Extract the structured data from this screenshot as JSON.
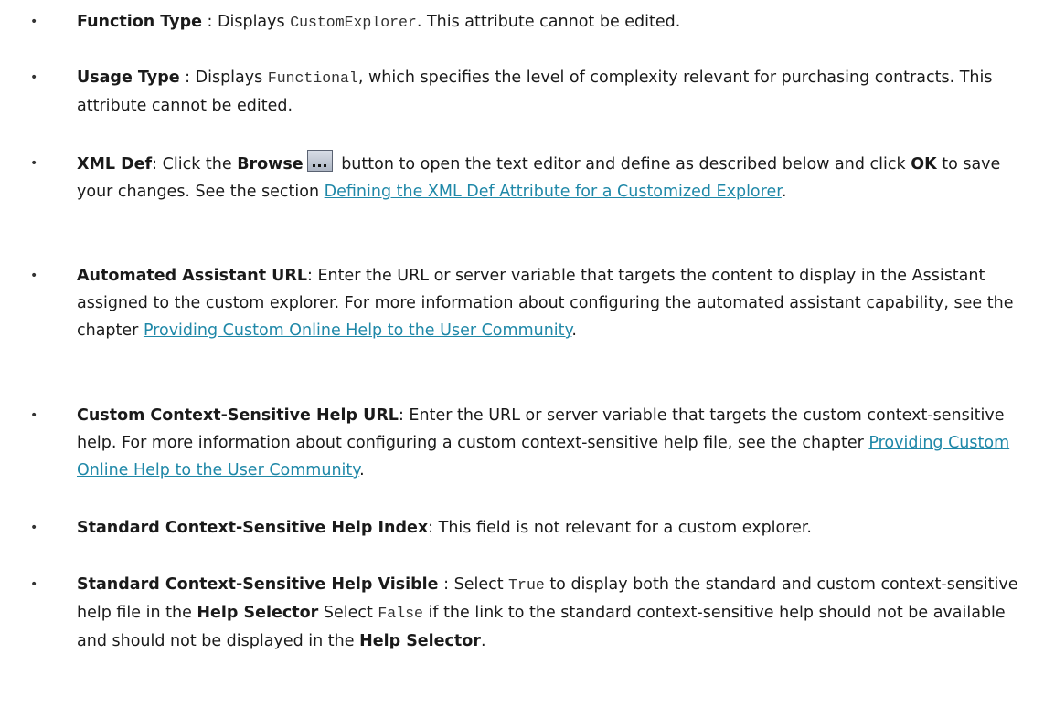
{
  "bullet_char": "•",
  "items": [
    {
      "label": "Function Type",
      "sep": " : Displays ",
      "code": "CustomExplorer",
      "rest": ". This attribute cannot be edited."
    },
    {
      "label": "Usage Type",
      "sep": " : Displays ",
      "code": "Functional",
      "rest": ", which specifies the level of complexity relevant for purchasing contracts. This attribute cannot be edited."
    },
    {
      "label": "XML Def",
      "t1": ": Click the ",
      "browse": "Browse",
      "icon": "browse-button-icon",
      "t2": " button to open the text editor and define as described below and click ",
      "ok": "OK",
      "t3": " to save your changes. See the section ",
      "link": "Defining the XML Def Attribute for a Customized Explorer",
      "t4": "."
    },
    {
      "label": "Automated Assistant URL",
      "t1": ": Enter the URL or server variable that targets the content to display in the Assistant assigned to the custom explorer. For more information about configuring the automated assistant capability, see the chapter ",
      "link": "Providing Custom Online Help to the User Community",
      "t2": "."
    },
    {
      "label": "Custom Context-Sensitive Help URL",
      "t1": ": Enter the URL or server variable that targets the custom context-sensitive help. For more information about configuring a custom context-sensitive help file, see the chapter ",
      "link": "Providing Custom Online Help to the User Community",
      "t2": "."
    },
    {
      "label": "Standard Context-Sensitive Help Index",
      "t1": ": This field is not relevant for a custom explorer."
    },
    {
      "label": "Standard Context-Sensitive Help Visible",
      "t1": " : Select ",
      "code1": "True",
      "t2": " to display both the standard and custom context-sensitive help file in the ",
      "b1": "Help Selector",
      "t3": " Select ",
      "code2": "False",
      "t4": " if the link to the standard context-sensitive help should not be available and should not be displayed in the ",
      "b2": "Help Selector",
      "t5": "."
    }
  ],
  "colors": {
    "text": "#1a1a1a",
    "link": "#1f88a8"
  }
}
